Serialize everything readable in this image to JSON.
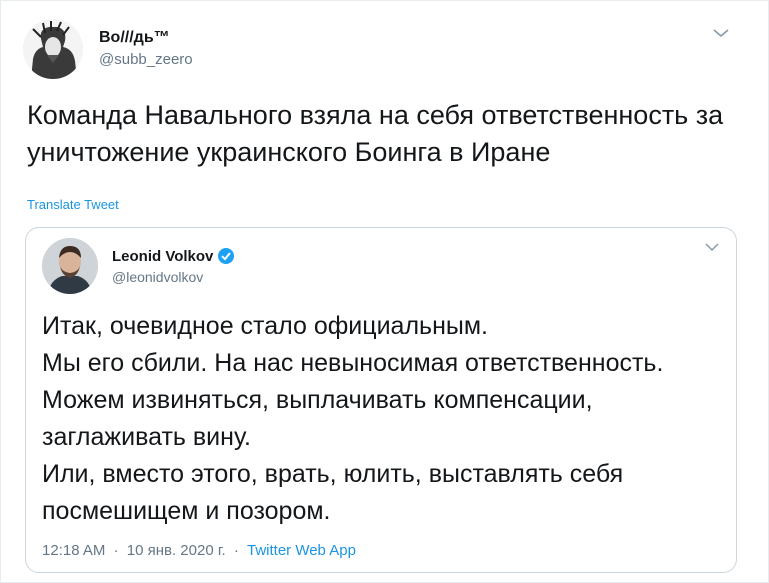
{
  "author": {
    "display_name": "Bo///дь™",
    "handle": "@subb_zeero"
  },
  "tweet_text": "Команда Навального взяла на себя ответственность за уничтожение украинского Боинга в Иране",
  "translate_label": "Translate Tweet",
  "quoted": {
    "display_name": "Leonid Volkov",
    "handle": "@leonidvolkov",
    "verified": true,
    "lines": [
      "Итак, очевидное стало официальным.",
      "Мы его сбили. На нас невыносимая ответственность.",
      "Можем извиняться, выплачивать компенсации,",
      "заглаживать вину.",
      "Или, вместо этого, врать, юлить, выставлять себя",
      "посмешищем и позором."
    ],
    "time": "12:18 AM",
    "date": "10 янв. 2020 г.",
    "separator": "·",
    "source": "Twitter Web App"
  },
  "icons": {
    "menu": "chevron-down-icon",
    "verified": "verified-badge-icon"
  },
  "colors": {
    "link": "#1b95e0",
    "secondary_text": "#657786",
    "border": "#ccd6dd",
    "verified": "#1da1f2"
  }
}
